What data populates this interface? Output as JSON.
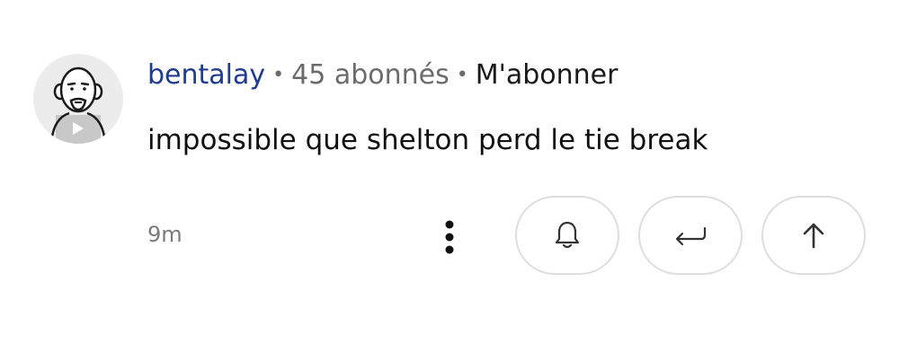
{
  "comment": {
    "author": "bentalay",
    "separator": "•",
    "followers": "45 abonnés",
    "subscribe_label": "M'abonner",
    "text": "impossible que shelton perd le tie break",
    "timestamp": "9m"
  },
  "icons": {
    "avatar": "bald-man-avatar-icon",
    "more": "vertical-dots-icon",
    "notify": "bell-icon",
    "reply": "reply-arrow-icon",
    "upvote": "arrow-up-icon"
  },
  "colors": {
    "username": "#1f3d8f",
    "meta_gray": "#6b6b6b",
    "text": "#111111",
    "pill_border": "#dedede"
  }
}
